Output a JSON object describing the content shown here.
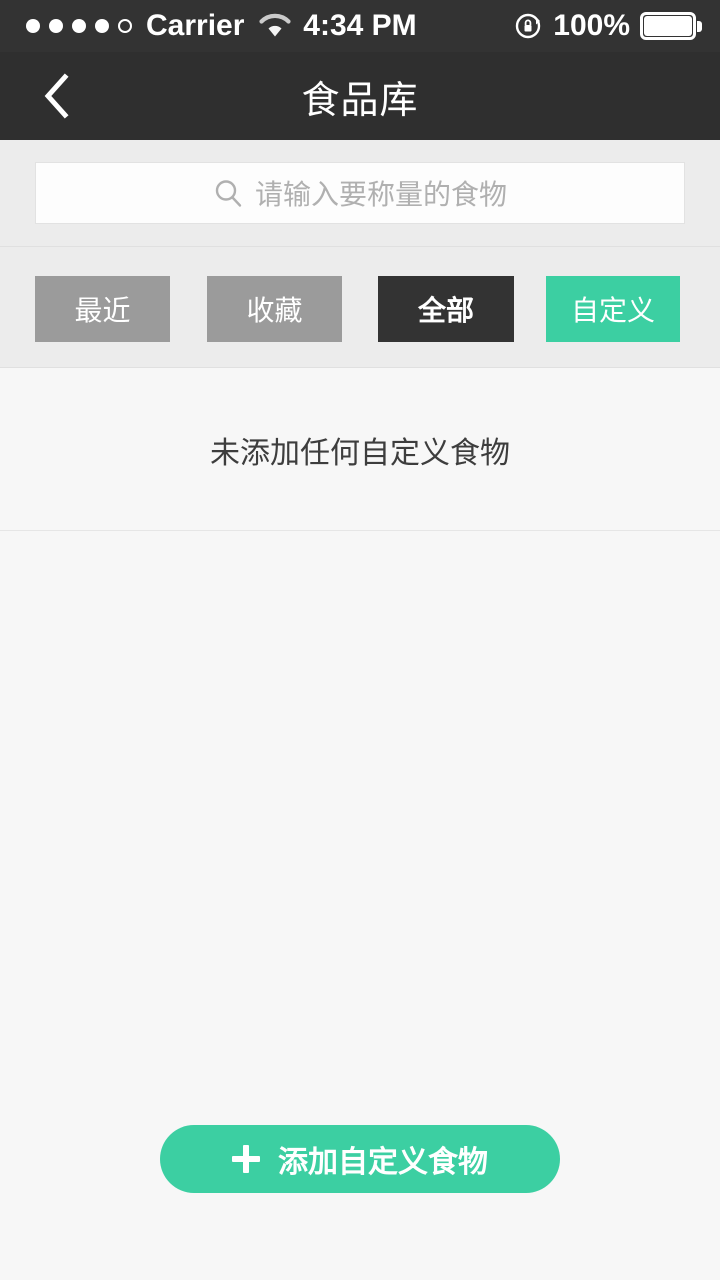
{
  "status_bar": {
    "signal_dots_filled": 4,
    "signal_dots_total": 5,
    "carrier": "Carrier",
    "wifi_icon": "wifi-icon",
    "time": "4:34 PM",
    "rotation_lock_icon": "rotation-lock-icon",
    "battery_percent": "100%",
    "battery_icon": "battery-full-icon",
    "background_color": "#333333"
  },
  "navbar": {
    "back_icon": "chevron-left-icon",
    "title": "食品库",
    "background_color": "#2f2f2f"
  },
  "search": {
    "icon": "search-icon",
    "placeholder": "请输入要称量的食物",
    "value": ""
  },
  "tabs": {
    "items": [
      {
        "label": "最近",
        "active": false,
        "color": "#9b9b9b"
      },
      {
        "label": "收藏",
        "active": false,
        "color": "#9b9b9b"
      },
      {
        "label": "全部",
        "active": true,
        "color": "#333333"
      },
      {
        "label": "自定义",
        "active": false,
        "color": "#3ccfa2"
      }
    ]
  },
  "content": {
    "empty_message": "未添加任何自定义食物"
  },
  "bottom_action": {
    "icon": "plus-icon",
    "label": "添加自定义食物",
    "color": "#3ccfa2"
  }
}
